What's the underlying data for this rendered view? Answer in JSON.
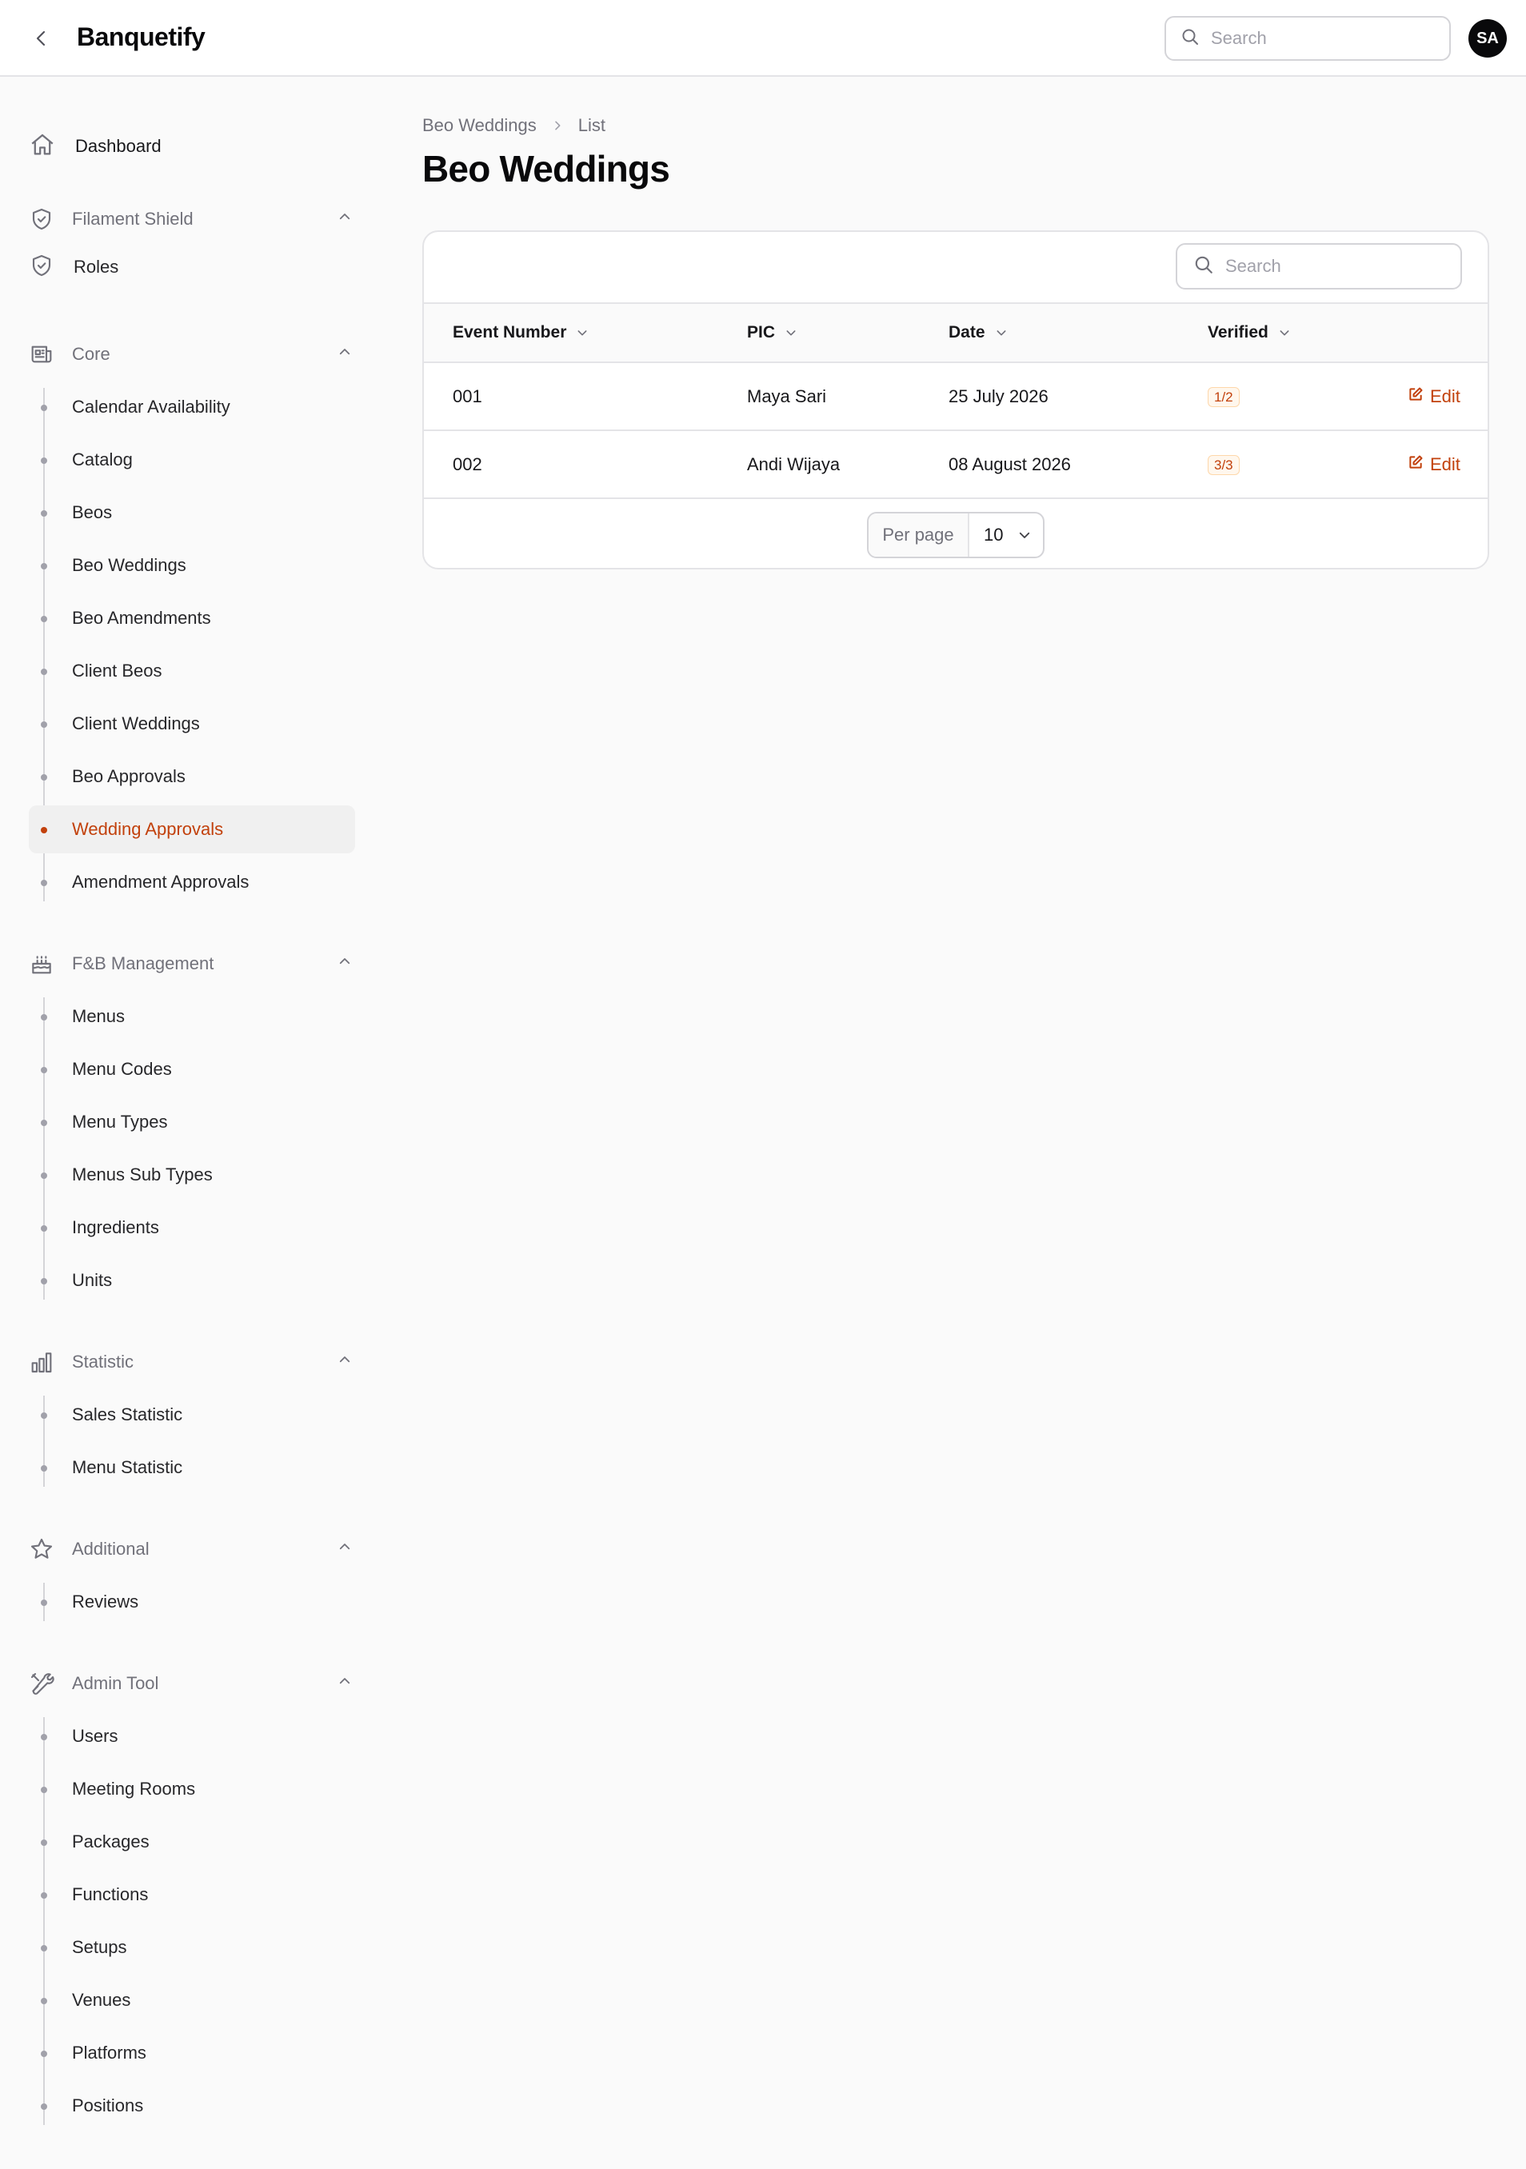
{
  "app": {
    "title": "Banquetify"
  },
  "header": {
    "search_placeholder": "Search",
    "avatar_initials": "SA"
  },
  "sidebar": {
    "dashboard": "Dashboard",
    "groups": [
      {
        "title": "Filament Shield",
        "items": [
          "Roles"
        ]
      },
      {
        "title": "Core",
        "items": [
          "Calendar Availability",
          "Catalog",
          "Beos",
          "Beo Weddings",
          "Beo Amendments",
          "Client Beos",
          "Client Weddings",
          "Beo Approvals",
          "Wedding Approvals",
          "Amendment Approvals"
        ]
      },
      {
        "title": "F&B Management",
        "items": [
          "Menus",
          "Menu Codes",
          "Menu Types",
          "Menus Sub Types",
          "Ingredients",
          "Units"
        ]
      },
      {
        "title": "Statistic",
        "items": [
          "Sales Statistic",
          "Menu Statistic"
        ]
      },
      {
        "title": "Additional",
        "items": [
          "Reviews"
        ]
      },
      {
        "title": "Admin Tool",
        "items": [
          "Users",
          "Meeting Rooms",
          "Packages",
          "Functions",
          "Setups",
          "Venues",
          "Platforms",
          "Positions"
        ]
      }
    ],
    "active_item": "Wedding Approvals"
  },
  "breadcrumb": [
    "Beo Weddings",
    "List"
  ],
  "page": {
    "title": "Beo Weddings"
  },
  "table": {
    "search_placeholder": "Search",
    "columns": [
      "Event Number",
      "PIC",
      "Date",
      "Verified"
    ],
    "rows": [
      {
        "event_number": "001",
        "pic": "Maya Sari",
        "date": "25 July 2026",
        "verified": "1/2",
        "action": "Edit"
      },
      {
        "event_number": "002",
        "pic": "Andi Wijaya",
        "date": "08 August 2026",
        "verified": "3/3",
        "action": "Edit"
      }
    ],
    "pagination": {
      "per_page_label": "Per page",
      "per_page_value": "10"
    }
  },
  "colors": {
    "accent": "#c2410c",
    "badge_bg": "#fff7ed"
  }
}
